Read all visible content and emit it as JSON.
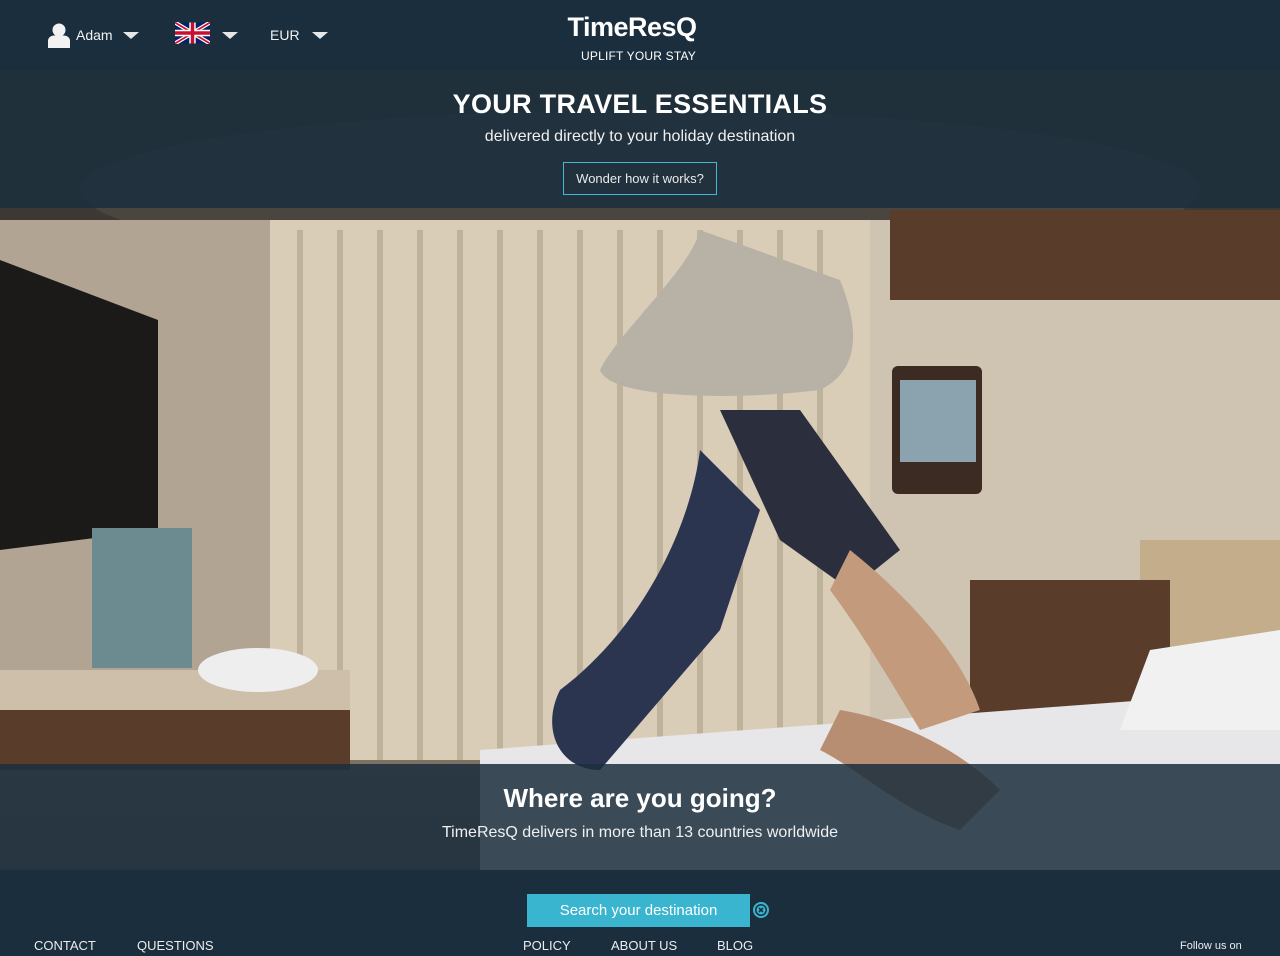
{
  "header": {
    "user_name": "Adam",
    "currency": "EUR",
    "logo_text": "TimeResQ",
    "logo_tagline": "UPLIFT YOUR STAY"
  },
  "hero": {
    "title": "YOUR TRAVEL ESSENTIALS",
    "subtitle": "delivered directly to your holiday destination",
    "how_button": "Wonder how it works?"
  },
  "destination": {
    "title": "Where are you going?",
    "subtitle": "TimeResQ delivers in more than 13 countries worldwide",
    "search_button": "Search your destination"
  },
  "footer": {
    "contact": "CONTACT",
    "questions": "QUESTIONS",
    "policy": "POLICY",
    "about": "ABOUT US",
    "blog": "BLOG",
    "follow": "Follow us on"
  },
  "colors": {
    "navy": "#1b2e3d",
    "accent": "#3ab5cf"
  },
  "icons": [
    "user-icon",
    "uk-flag-icon",
    "caret-down-icon",
    "clear-icon"
  ]
}
